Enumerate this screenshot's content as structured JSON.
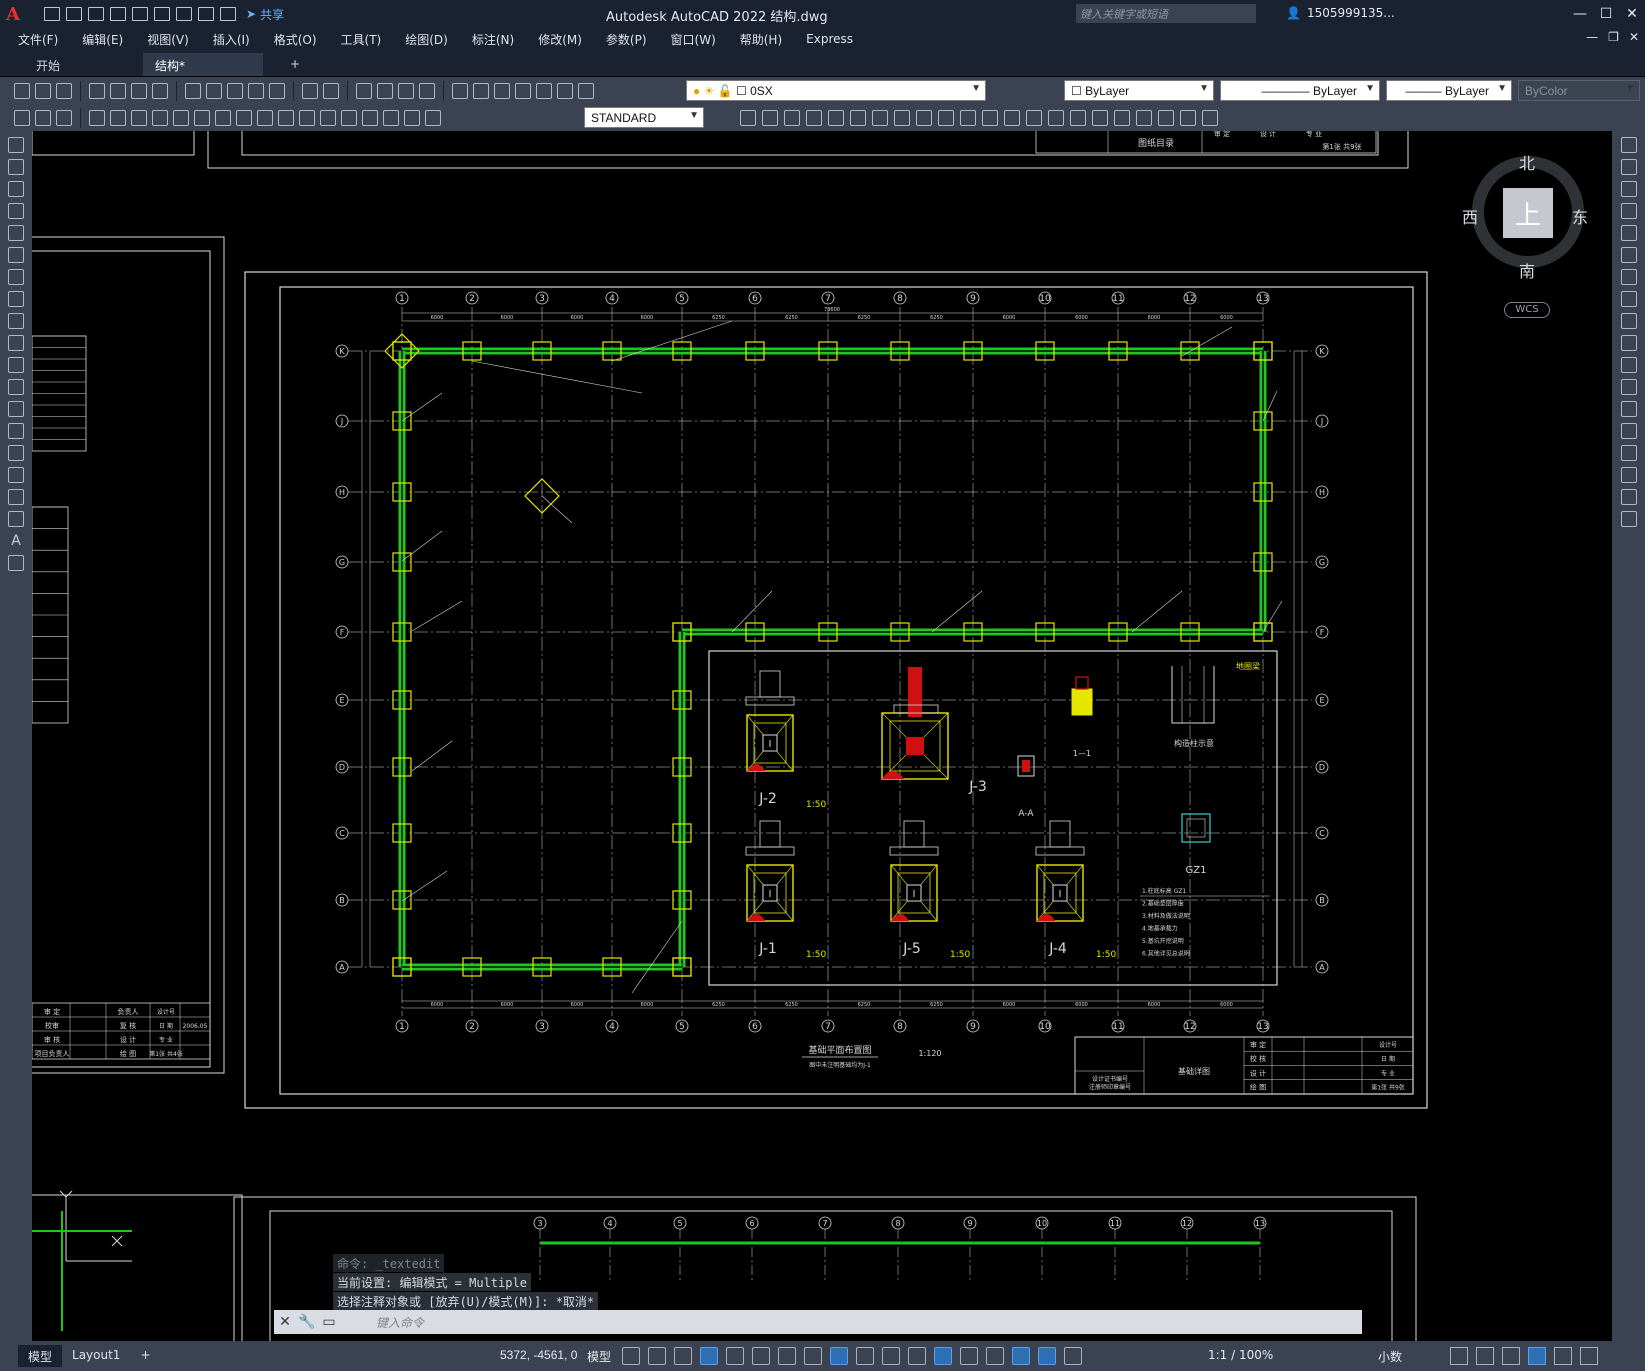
{
  "titlebar": {
    "logo": "A",
    "share_label": "共享",
    "app_title": "Autodesk AutoCAD 2022    结构.dwg",
    "search_placeholder": "键入关键字或短语",
    "user": "1505999135...",
    "min": "—",
    "max": "☐",
    "close": "✕"
  },
  "menu": [
    "文件(F)",
    "编辑(E)",
    "视图(V)",
    "插入(I)",
    "格式(O)",
    "工具(T)",
    "绘图(D)",
    "标注(N)",
    "修改(M)",
    "参数(P)",
    "窗口(W)",
    "帮助(H)",
    "Express"
  ],
  "tabs": {
    "start": "开始",
    "doc": "结构*",
    "close": "✕",
    "add": "+"
  },
  "toolbar": {
    "layer": "0SX",
    "color": "ByLayer",
    "linetype": "ByLayer",
    "lineweight": "ByLayer",
    "plotstyle": "ByColor",
    "textstyle": "STANDARD"
  },
  "left_tool_text": "A",
  "viewcube": {
    "north": "北",
    "south": "南",
    "west": "西",
    "east": "东",
    "face": "上",
    "wcs": "WCS"
  },
  "drawing": {
    "axes_num": [
      "1",
      "2",
      "3",
      "4",
      "5",
      "6",
      "7",
      "8",
      "9",
      "10",
      "11",
      "12",
      "13"
    ],
    "axes_letter": [
      "K",
      "J",
      "H",
      "G",
      "F",
      "E",
      "D",
      "C",
      "B",
      "A"
    ],
    "spacings": [
      "6000",
      "6000",
      "6000",
      "6000",
      "6250",
      "6250",
      "6250",
      "6250",
      "6000",
      "6000",
      "6000",
      "6000"
    ],
    "total_top": "73600",
    "plan_title": "基础平面布置图",
    "plan_scale": "1:120",
    "plan_note": "图中未注明基础均为J-1",
    "details": [
      {
        "label": "J-2",
        "scale": "1:50"
      },
      {
        "label": "J-3",
        "scale": ""
      },
      {
        "label": "J-1",
        "scale": "1:50"
      },
      {
        "label": "J-5",
        "scale": "1:50"
      },
      {
        "label": "J-4",
        "scale": "1:50"
      }
    ],
    "section_aa": "A-A",
    "section_11": "1—1",
    "gz1": "GZ1",
    "gouzao": "构造柱示意",
    "ground": "地圈梁",
    "detail_marks": [
      "I",
      "I",
      "I",
      "I",
      "I"
    ],
    "notes": [
      "1.柱底标高 GZ1",
      "2.基础垫层厚度",
      "3.材料及做法说明",
      "4.地基承载力",
      "5.基坑开挖说明",
      "6.其他详见总说明"
    ],
    "tb_design": [
      "审 定",
      "校 核",
      "设 计",
      "绘 图"
    ],
    "tb_right": [
      "设计号",
      "日 期",
      "专 业",
      "第1张 共9张"
    ],
    "tb_sheet": "基础详图",
    "tb_cert": "设计证书编号",
    "tb_cert2": "注册师印章编号",
    "upper_tb": "图纸目录",
    "upper_sheet": "第1张 共9张",
    "upper_tb_left": [
      "审 定",
      "设 计",
      "专 业"
    ],
    "left_tb": [
      "审 定",
      "校审",
      "审 核",
      "项目负责人"
    ],
    "left_tb_mid": [
      "负责人",
      "复 核",
      "设 计",
      "绘 图"
    ],
    "left_tb_right": [
      "设计号",
      "日 期",
      "专 业",
      "第1张 共4张"
    ],
    "left_tb_date": "2006.05",
    "bottom_axes": [
      "3",
      "4",
      "5",
      "6",
      "7",
      "8",
      "9",
      "10",
      "11",
      "12",
      "13"
    ]
  },
  "command": {
    "history": [
      "命令: _textedit",
      "当前设置: 编辑模式 = Multiple",
      "选择注释对象或 [放弃(U)/模式(M)]: *取消*"
    ],
    "placeholder": "键入命令"
  },
  "status": {
    "model_tab": "模型",
    "layout_tab": "Layout1",
    "add_tab": "+",
    "coords": "5372, -4561, 0",
    "model": "模型",
    "scale": "1:1 / 100%",
    "units": "小数"
  },
  "colors": {
    "ui_dark": "#1a2231",
    "ui_mid": "#3b4353",
    "wall_green": "#22c422",
    "column_yellow": "#e6e600",
    "hatch_red": "#d01010"
  }
}
